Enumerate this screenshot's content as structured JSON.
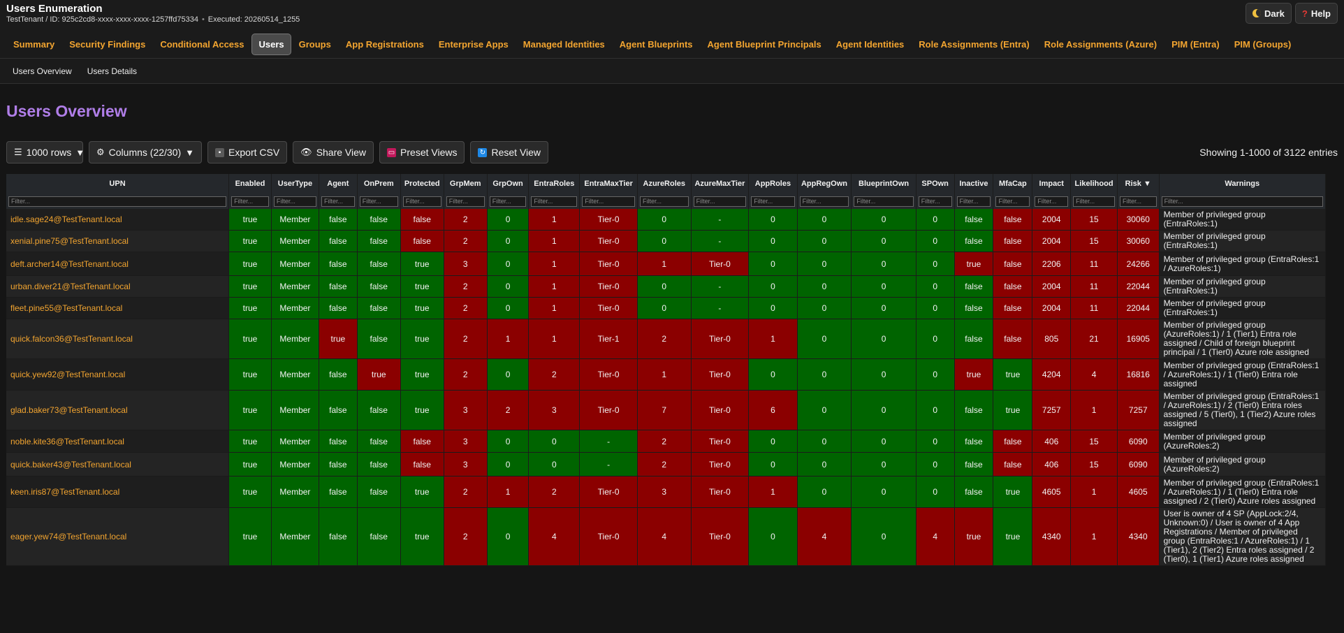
{
  "header": {
    "title": "Users Enumeration",
    "tenant_line": "TestTenant / ID: 925c2cd8-xxxx-xxxx-xxxx-1257ffd75334",
    "executed": "Executed: 20260514_1255",
    "dark_label": "Dark",
    "help_label": "Help"
  },
  "nav": {
    "tabs": [
      "Summary",
      "Security Findings",
      "Conditional Access",
      "Users",
      "Groups",
      "App Registrations",
      "Enterprise Apps",
      "Managed Identities",
      "Agent Blueprints",
      "Agent Blueprint Principals",
      "Agent Identities",
      "Role Assignments (Entra)",
      "Role Assignments (Azure)",
      "PIM (Entra)",
      "PIM (Groups)"
    ],
    "active": "Users"
  },
  "subnav": {
    "tabs": [
      "Users Overview",
      "Users Details"
    ]
  },
  "page": {
    "title": "Users Overview"
  },
  "toolbar": {
    "rows_label": "1000 rows",
    "columns_label": "Columns (22/30)",
    "export_label": "Export CSV",
    "share_label": "Share View",
    "preset_label": "Preset Views",
    "reset_label": "Reset View",
    "entries_text": "Showing 1-1000 of 3122 entries"
  },
  "colors": {
    "green": "#006400",
    "red": "#8b0000",
    "accent": "#f3a530",
    "title": "#b07ee8"
  },
  "table": {
    "filter_placeholder": "Filter...",
    "columns": [
      "UPN",
      "Enabled",
      "UserType",
      "Agent",
      "OnPrem",
      "Protected",
      "GrpMem",
      "GrpOwn",
      "EntraRoles",
      "EntraMaxTier",
      "AzureRoles",
      "AzureMaxTier",
      "AppRoles",
      "AppRegOwn",
      "BlueprintOwn",
      "SPOwn",
      "Inactive",
      "MfaCap",
      "Impact",
      "Likelihood",
      "Risk ▼",
      "Warnings"
    ],
    "rows": [
      {
        "cells": [
          "idle.sage24@TestTenant.local",
          "true",
          "Member",
          "false",
          "false",
          "false",
          "2",
          "0",
          "1",
          "Tier-0",
          "0",
          "-",
          "0",
          "0",
          "0",
          "0",
          "false",
          "false",
          "2004",
          "15",
          "30060",
          "Member of privileged group (EntraRoles:1)"
        ],
        "colors": [
          "",
          "g",
          "g",
          "g",
          "g",
          "r",
          "r",
          "g",
          "r",
          "r",
          "g",
          "g",
          "g",
          "g",
          "g",
          "g",
          "g",
          "r",
          "r",
          "r",
          "r",
          ""
        ]
      },
      {
        "cells": [
          "xenial.pine75@TestTenant.local",
          "true",
          "Member",
          "false",
          "false",
          "false",
          "2",
          "0",
          "1",
          "Tier-0",
          "0",
          "-",
          "0",
          "0",
          "0",
          "0",
          "false",
          "false",
          "2004",
          "15",
          "30060",
          "Member of privileged group (EntraRoles:1)"
        ],
        "colors": [
          "",
          "g",
          "g",
          "g",
          "g",
          "r",
          "r",
          "g",
          "r",
          "r",
          "g",
          "g",
          "g",
          "g",
          "g",
          "g",
          "g",
          "r",
          "r",
          "r",
          "r",
          ""
        ]
      },
      {
        "cells": [
          "deft.archer14@TestTenant.local",
          "true",
          "Member",
          "false",
          "false",
          "true",
          "3",
          "0",
          "1",
          "Tier-0",
          "1",
          "Tier-0",
          "0",
          "0",
          "0",
          "0",
          "true",
          "false",
          "2206",
          "11",
          "24266",
          "Member of privileged group (EntraRoles:1 / AzureRoles:1)"
        ],
        "colors": [
          "",
          "g",
          "g",
          "g",
          "g",
          "g",
          "r",
          "g",
          "r",
          "r",
          "r",
          "r",
          "g",
          "g",
          "g",
          "g",
          "r",
          "r",
          "r",
          "r",
          "r",
          ""
        ]
      },
      {
        "cells": [
          "urban.diver21@TestTenant.local",
          "true",
          "Member",
          "false",
          "false",
          "true",
          "2",
          "0",
          "1",
          "Tier-0",
          "0",
          "-",
          "0",
          "0",
          "0",
          "0",
          "false",
          "false",
          "2004",
          "11",
          "22044",
          "Member of privileged group (EntraRoles:1)"
        ],
        "colors": [
          "",
          "g",
          "g",
          "g",
          "g",
          "g",
          "r",
          "g",
          "r",
          "r",
          "g",
          "g",
          "g",
          "g",
          "g",
          "g",
          "g",
          "r",
          "r",
          "r",
          "r",
          ""
        ]
      },
      {
        "cells": [
          "fleet.pine55@TestTenant.local",
          "true",
          "Member",
          "false",
          "false",
          "true",
          "2",
          "0",
          "1",
          "Tier-0",
          "0",
          "-",
          "0",
          "0",
          "0",
          "0",
          "false",
          "false",
          "2004",
          "11",
          "22044",
          "Member of privileged group (EntraRoles:1)"
        ],
        "colors": [
          "",
          "g",
          "g",
          "g",
          "g",
          "g",
          "r",
          "g",
          "r",
          "r",
          "g",
          "g",
          "g",
          "g",
          "g",
          "g",
          "g",
          "r",
          "r",
          "r",
          "r",
          ""
        ]
      },
      {
        "cells": [
          "quick.falcon36@TestTenant.local",
          "true",
          "Member",
          "true",
          "false",
          "true",
          "2",
          "1",
          "1",
          "Tier-1",
          "2",
          "Tier-0",
          "1",
          "0",
          "0",
          "0",
          "false",
          "false",
          "805",
          "21",
          "16905",
          "Member of privileged group (AzureRoles:1) / 1 (Tier1) Entra role assigned / Child of foreign blueprint principal / 1 (Tier0) Azure role assigned"
        ],
        "colors": [
          "",
          "g",
          "g",
          "r",
          "g",
          "g",
          "r",
          "r",
          "r",
          "r",
          "r",
          "r",
          "r",
          "g",
          "g",
          "g",
          "g",
          "r",
          "r",
          "r",
          "r",
          ""
        ]
      },
      {
        "cells": [
          "quick.yew92@TestTenant.local",
          "true",
          "Member",
          "false",
          "true",
          "true",
          "2",
          "0",
          "2",
          "Tier-0",
          "1",
          "Tier-0",
          "0",
          "0",
          "0",
          "0",
          "true",
          "true",
          "4204",
          "4",
          "16816",
          "Member of privileged group (EntraRoles:1 / AzureRoles:1) / 1 (Tier0) Entra role assigned"
        ],
        "colors": [
          "",
          "g",
          "g",
          "g",
          "r",
          "g",
          "r",
          "g",
          "r",
          "r",
          "r",
          "r",
          "g",
          "g",
          "g",
          "g",
          "r",
          "g",
          "r",
          "r",
          "r",
          ""
        ]
      },
      {
        "cells": [
          "glad.baker73@TestTenant.local",
          "true",
          "Member",
          "false",
          "false",
          "true",
          "3",
          "2",
          "3",
          "Tier-0",
          "7",
          "Tier-0",
          "6",
          "0",
          "0",
          "0",
          "false",
          "true",
          "7257",
          "1",
          "7257",
          "Member of privileged group (EntraRoles:1 / AzureRoles:1) / 2 (Tier0) Entra roles assigned / 5 (Tier0), 1 (Tier2) Azure roles assigned"
        ],
        "colors": [
          "",
          "g",
          "g",
          "g",
          "g",
          "g",
          "r",
          "r",
          "r",
          "r",
          "r",
          "r",
          "r",
          "g",
          "g",
          "g",
          "g",
          "g",
          "r",
          "r",
          "r",
          ""
        ]
      },
      {
        "cells": [
          "noble.kite36@TestTenant.local",
          "true",
          "Member",
          "false",
          "false",
          "false",
          "3",
          "0",
          "0",
          "-",
          "2",
          "Tier-0",
          "0",
          "0",
          "0",
          "0",
          "false",
          "false",
          "406",
          "15",
          "6090",
          "Member of privileged group (AzureRoles:2)"
        ],
        "colors": [
          "",
          "g",
          "g",
          "g",
          "g",
          "r",
          "r",
          "g",
          "g",
          "g",
          "r",
          "r",
          "g",
          "g",
          "g",
          "g",
          "g",
          "r",
          "r",
          "r",
          "r",
          ""
        ]
      },
      {
        "cells": [
          "quick.baker43@TestTenant.local",
          "true",
          "Member",
          "false",
          "false",
          "false",
          "3",
          "0",
          "0",
          "-",
          "2",
          "Tier-0",
          "0",
          "0",
          "0",
          "0",
          "false",
          "false",
          "406",
          "15",
          "6090",
          "Member of privileged group (AzureRoles:2)"
        ],
        "colors": [
          "",
          "g",
          "g",
          "g",
          "g",
          "r",
          "r",
          "g",
          "g",
          "g",
          "r",
          "r",
          "g",
          "g",
          "g",
          "g",
          "g",
          "r",
          "r",
          "r",
          "r",
          ""
        ]
      },
      {
        "cells": [
          "keen.iris87@TestTenant.local",
          "true",
          "Member",
          "false",
          "false",
          "true",
          "2",
          "1",
          "2",
          "Tier-0",
          "3",
          "Tier-0",
          "1",
          "0",
          "0",
          "0",
          "false",
          "true",
          "4605",
          "1",
          "4605",
          "Member of privileged group (EntraRoles:1 / AzureRoles:1) / 1 (Tier0) Entra role assigned / 2 (Tier0) Azure roles assigned"
        ],
        "colors": [
          "",
          "g",
          "g",
          "g",
          "g",
          "g",
          "r",
          "r",
          "r",
          "r",
          "r",
          "r",
          "r",
          "g",
          "g",
          "g",
          "g",
          "g",
          "r",
          "r",
          "r",
          ""
        ]
      },
      {
        "cells": [
          "eager.yew74@TestTenant.local",
          "true",
          "Member",
          "false",
          "false",
          "true",
          "2",
          "0",
          "4",
          "Tier-0",
          "4",
          "Tier-0",
          "0",
          "4",
          "0",
          "4",
          "true",
          "true",
          "4340",
          "1",
          "4340",
          "User is owner of 4 SP (AppLock:2/4, Unknown:0) / User is owner of 4 App Registrations / Member of privileged group (EntraRoles:1 / AzureRoles:1) / 1 (Tier1), 2 (Tier2) Entra roles assigned / 2 (Tier0), 1 (Tier1) Azure roles assigned"
        ],
        "colors": [
          "",
          "g",
          "g",
          "g",
          "g",
          "g",
          "r",
          "g",
          "r",
          "r",
          "r",
          "r",
          "g",
          "r",
          "g",
          "r",
          "r",
          "g",
          "r",
          "r",
          "r",
          ""
        ]
      }
    ]
  }
}
